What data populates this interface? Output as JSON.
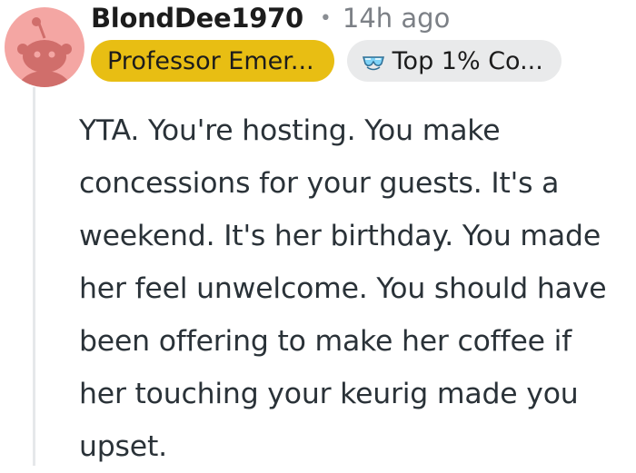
{
  "comment": {
    "author": "BlondDee1970",
    "separator": "•",
    "timestamp": "14h ago",
    "flairs": {
      "primary": "Professor Emer...",
      "secondary": "Top 1% Co...",
      "secondary_icon": "sunglasses-icon"
    },
    "avatar_icon": "reddit-snoo-avatar-icon",
    "body": "YTA. You're hosting. You make concessions for your guests. It's a weekend. It's her birthday. You made her feel unwelcome. You should have been offering to make her coffee if her touching your keurig made you upset."
  },
  "colors": {
    "avatar_bg": "#f4a6a3",
    "flair_primary_bg": "#e8be13",
    "flair_secondary_bg": "#e9eaeb",
    "thread_line": "#e6e8ea"
  }
}
